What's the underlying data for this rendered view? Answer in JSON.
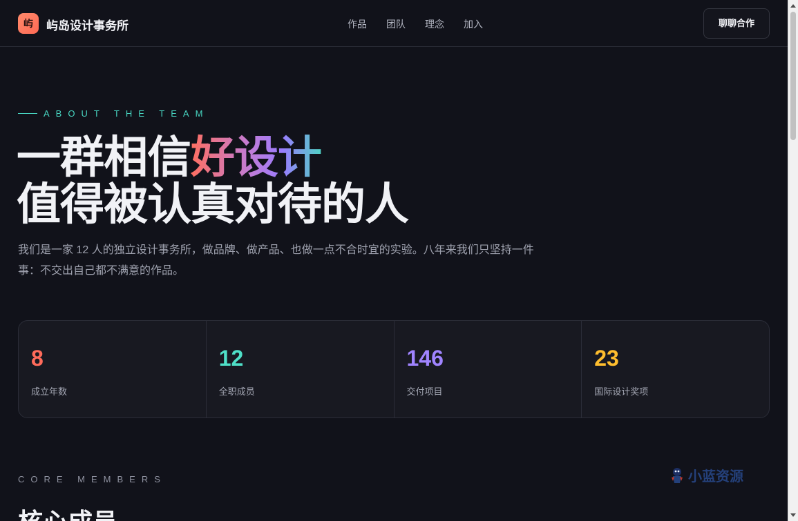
{
  "nav": {
    "logo_char": "屿",
    "logo_name": "屿岛设计事务所",
    "links": [
      "作品",
      "团队",
      "理念",
      "加入"
    ],
    "cta_label": "聊聊合作"
  },
  "hero": {
    "eyebrow": "ABOUT THE TEAM",
    "headline_line1_plain": "一群相信",
    "headline_line1_highlight": "好设计",
    "headline_line2": "值得被认真对待的人",
    "intro": "我们是一家 12 人的独立设计事务所，做品牌、做产品、也做一点不合时宜的实验。八年来我们只坚持一件事：不交出自己都不满意的作品。"
  },
  "stats": [
    {
      "value": "8",
      "label": "成立年数",
      "color": "#ff6b5b"
    },
    {
      "value": "12",
      "label": "全职成员",
      "color": "#4fe0c8"
    },
    {
      "value": "146",
      "label": "交付项目",
      "color": "#a084ff"
    },
    {
      "value": "23",
      "label": "国际设计奖项",
      "color": "#ffbe2e"
    }
  ],
  "members": {
    "eyebrow": "CORE MEMBERS",
    "title": "核心成员"
  },
  "watermark": {
    "text": "小蓝资源",
    "icon": "mascot-icon"
  }
}
